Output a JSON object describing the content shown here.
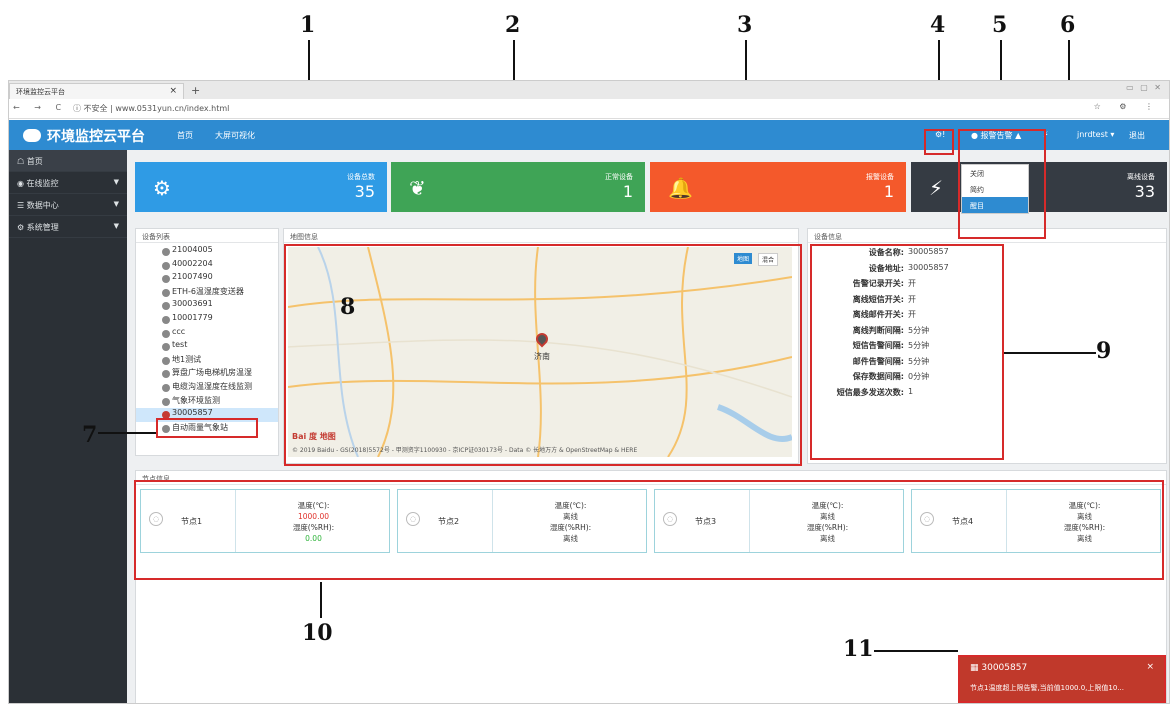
{
  "callouts": [
    "1",
    "2",
    "3",
    "4",
    "5",
    "6",
    "7",
    "8",
    "9",
    "10",
    "11"
  ],
  "browser": {
    "tab_title": "环境监控云平台",
    "tab_close": "×",
    "new_tab": "+",
    "window_buttons": "▭ ▢ ✕",
    "nav": "← → C",
    "url": "ⓘ 不安全 | www.0531yun.cn/index.html",
    "right_icons": "☆ ⚙ ⋮"
  },
  "app": {
    "title": "环境监控云平台",
    "nav": [
      "首页",
      "大屏可视化"
    ],
    "header_icon": "⚙!",
    "alarm_menu": "● 报警告警 ▲",
    "settings_icon": "⚡",
    "user": "jnrdtest ▾",
    "logout": "退出",
    "accent": "#2e8bd1"
  },
  "sidebar": {
    "items": [
      {
        "label": "☖ 首页",
        "arrow": ""
      },
      {
        "label": "◉ 在线监控",
        "arrow": "▼"
      },
      {
        "label": "☰ 数据中心",
        "arrow": "▼"
      },
      {
        "label": "⚙ 系统管理",
        "arrow": "▼"
      }
    ]
  },
  "cards": [
    {
      "title": "设备总数",
      "value": "35",
      "color": "#2f9be5",
      "icon": "⚙"
    },
    {
      "title": "正常设备",
      "value": "1",
      "color": "#3fa456",
      "icon": "❦"
    },
    {
      "title": "报警设备",
      "value": "1",
      "color": "#f4592b",
      "icon": "🔔"
    },
    {
      "title": "离线设备",
      "value": "33",
      "color": "#353b43",
      "icon": "⚡"
    }
  ],
  "alarm_dropdown": {
    "items": [
      "关闭",
      "简约",
      "醒目"
    ],
    "selected": "醒目"
  },
  "device_list": {
    "title": "设备列表",
    "items": [
      "21004005",
      "40002204",
      "21007490",
      "ETH-6温湿度变送器",
      "30003691",
      "10001779",
      "ccc",
      "test",
      "地1测试",
      "算盘广场电梯机房温湿",
      "电缆沟温湿度在线监测",
      "气象环境监测",
      "30005857",
      "自动雨量气象站"
    ],
    "selected": "30005857"
  },
  "map": {
    "title": "地图信息",
    "city": "济南",
    "copyright": "© 2019 Baidu - GS(2018)5572号 - 甲测资字1100930 - 京ICP证030173号 - Data © 长地万方 & OpenStreetMap & HERE",
    "baidu": "Bai 度 地图",
    "map_btn": "地图",
    "sat_btn": "混合"
  },
  "device_info": {
    "title": "设备信息",
    "rows": [
      {
        "k": "设备名称:",
        "v": "30005857"
      },
      {
        "k": "设备地址:",
        "v": "30005857"
      },
      {
        "k": "告警记录开关:",
        "v": "开"
      },
      {
        "k": "离线短信开关:",
        "v": "开"
      },
      {
        "k": "离线邮件开关:",
        "v": "开"
      },
      {
        "k": "离线判断间隔:",
        "v": "5分钟"
      },
      {
        "k": "短信告警间隔:",
        "v": "5分钟"
      },
      {
        "k": "邮件告警间隔:",
        "v": "5分钟"
      },
      {
        "k": "保存数据间隔:",
        "v": "0分钟"
      },
      {
        "k": "短信最多发送次数:",
        "v": "1"
      }
    ]
  },
  "nodes": {
    "title": "节点信息",
    "items": [
      {
        "name": "节点1",
        "temp_label": "温度(℃):",
        "temp": "1000.00",
        "hum_label": "湿度(%RH):",
        "hum": "0.00",
        "temp_color": "#e0322b",
        "hum_color": "#2fb43b"
      },
      {
        "name": "节点2",
        "temp_label": "温度(℃):",
        "temp": "离线",
        "hum_label": "湿度(%RH):",
        "hum": "离线",
        "temp_color": "#444",
        "hum_color": "#444"
      },
      {
        "name": "节点3",
        "temp_label": "温度(℃):",
        "temp": "离线",
        "hum_label": "湿度(%RH):",
        "hum": "离线",
        "temp_color": "#444",
        "hum_color": "#444"
      },
      {
        "name": "节点4",
        "temp_label": "温度(℃):",
        "temp": "离线",
        "hum_label": "湿度(%RH):",
        "hum": "离线",
        "temp_color": "#444",
        "hum_color": "#444"
      }
    ]
  },
  "alert": {
    "title": "▦ 30005857",
    "close": "×",
    "message": "节点1温度超上限告警,当前值1000.0,上限值10..."
  }
}
